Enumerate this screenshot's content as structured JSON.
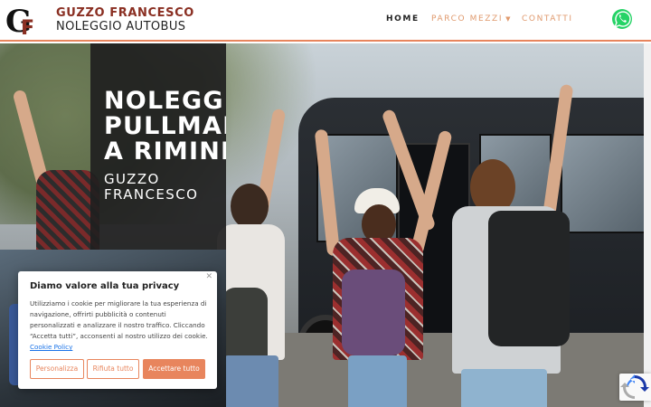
{
  "header": {
    "logo_mark": "GF",
    "brand_name": "GUZZO FRANCESCO",
    "brand_tagline": "NOLEGGIO AUTOBUS",
    "nav": [
      {
        "label": "HOME",
        "active": true
      },
      {
        "label": "PARCO MEZZI",
        "has_dropdown": true
      },
      {
        "label": "CONTATTI"
      }
    ],
    "whatsapp_icon": "whatsapp-icon"
  },
  "hero": {
    "title_lines": [
      "NOLEGGIO",
      "PULLMAN",
      "A RIMINI"
    ],
    "subtitle_lines": [
      "GUZZO",
      "FRANCESCO"
    ]
  },
  "cookie": {
    "title": "Diamo valore alla tua privacy",
    "text": "Utilizziamo i cookie per migliorare la tua esperienza di navigazione, offrirti pubblicità o contenuti personalizzati e analizzare il nostro traffico. Cliccando “Accetta tutti”, acconsenti al nostro utilizzo dei cookie.",
    "link": "Cookie Policy",
    "buttons": {
      "customize": "Personalizza",
      "reject": "Rifiuta tutto",
      "accept": "Accettare tutto"
    }
  },
  "colors": {
    "accent": "#e8855d",
    "brand_dark_red": "#8a2f22",
    "whatsapp_green": "#25d366"
  }
}
